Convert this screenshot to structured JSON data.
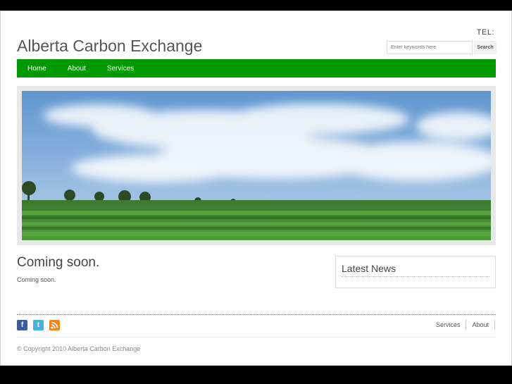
{
  "header": {
    "tel": "TEL:",
    "site_title": "Alberta Carbon Exchange",
    "search_placeholder": "Enter keywords here",
    "search_button": "Search"
  },
  "nav": {
    "items": [
      {
        "label": "Home"
      },
      {
        "label": "About"
      },
      {
        "label": "Services"
      }
    ],
    "color": "#009900"
  },
  "main": {
    "title": "Coming soon.",
    "text": "Coming soon."
  },
  "sidebar": {
    "news_title": "Latest News"
  },
  "footer": {
    "social_icons": [
      "facebook-icon",
      "twitter-icon",
      "rss-icon"
    ],
    "links": [
      {
        "label": "Services"
      },
      {
        "label": "About"
      }
    ],
    "copyright": "© Copyright 2010 Alberta Carbon Exchange"
  }
}
